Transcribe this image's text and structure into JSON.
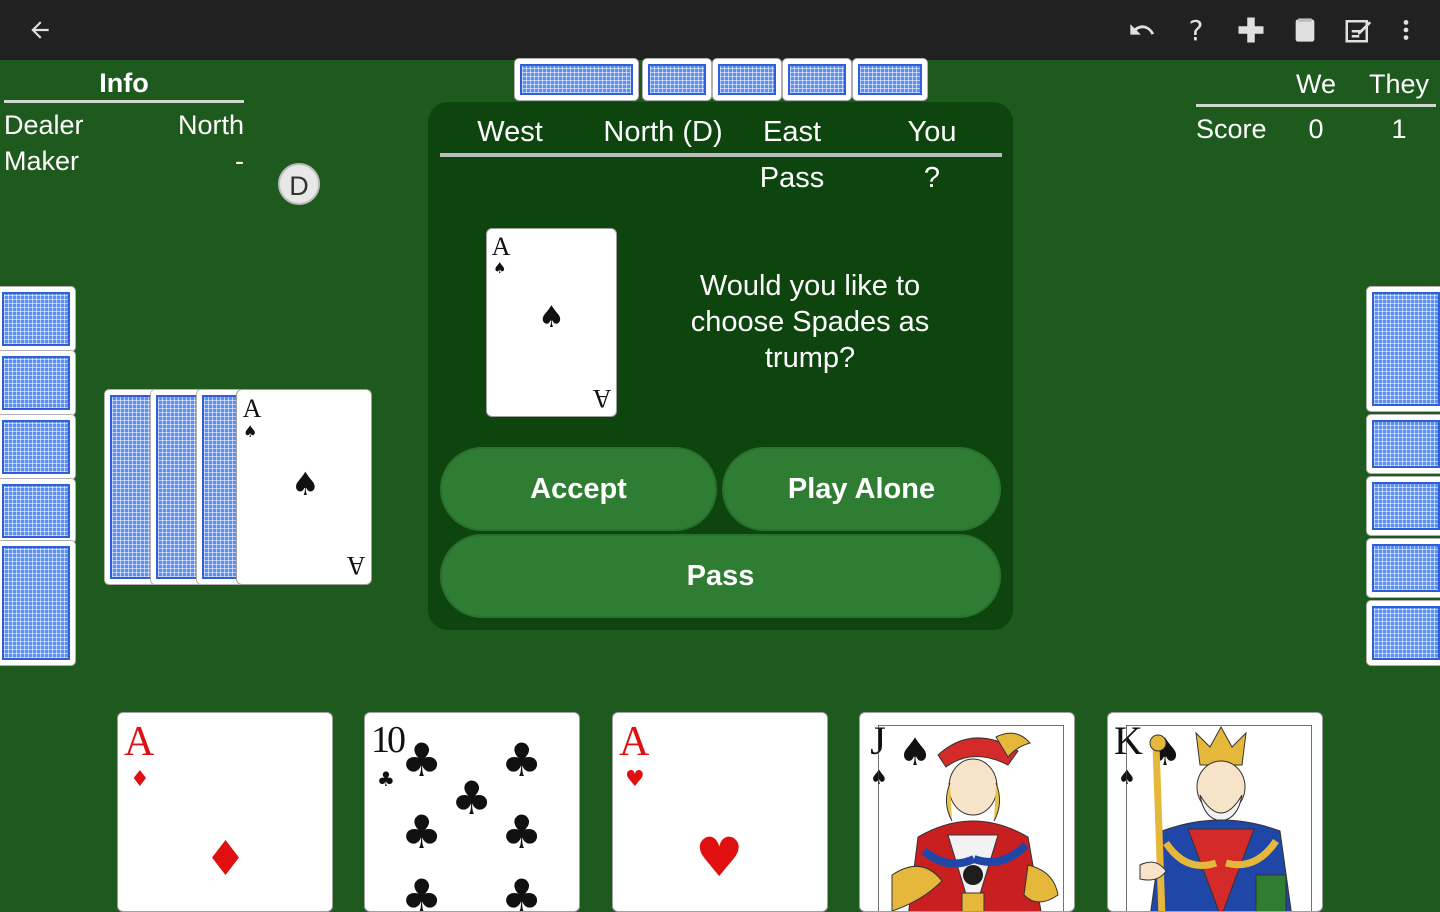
{
  "toolbar": {
    "back_icon": "arrow-left-icon",
    "undo_icon": "undo-icon",
    "help_label": "?",
    "plus_icon": "plus-icon",
    "cards_icon": "cards-icon",
    "scores_icon": "scores-icon",
    "more_icon": "more-vertical-icon"
  },
  "info": {
    "title": "Info",
    "dealer_label": "Dealer",
    "dealer_value": "North",
    "maker_label": "Maker",
    "maker_value": "-"
  },
  "score": {
    "col_we": "We",
    "col_they": "They",
    "row_label": "Score",
    "we_value": "0",
    "they_value": "1"
  },
  "dealer_chip": "D",
  "bidding": {
    "players": [
      "West",
      "North (D)",
      "East",
      "You"
    ],
    "bids": [
      "",
      "",
      "Pass",
      "?"
    ]
  },
  "upcard": {
    "rank": "A",
    "suit": "♠",
    "color": "#111111"
  },
  "question": "Would you like to choose Spades as trump?",
  "buttons": {
    "accept": "Accept",
    "play_alone": "Play Alone",
    "pass": "Pass"
  },
  "kitty_top": {
    "rank": "A",
    "suit": "♠"
  },
  "hand": [
    {
      "rank": "A",
      "suit": "♦",
      "color": "red"
    },
    {
      "rank": "10",
      "suit": "♣",
      "color": "black"
    },
    {
      "rank": "A",
      "suit": "♥",
      "color": "red"
    },
    {
      "rank": "J",
      "suit": "♠",
      "color": "black"
    },
    {
      "rank": "K",
      "suit": "♠",
      "color": "black"
    }
  ],
  "colors": {
    "table": "#1e5a1e",
    "dialog": "#0e450e",
    "button": "#2e7d32",
    "topbar": "#212121",
    "card_back": "#5b8ff0"
  }
}
